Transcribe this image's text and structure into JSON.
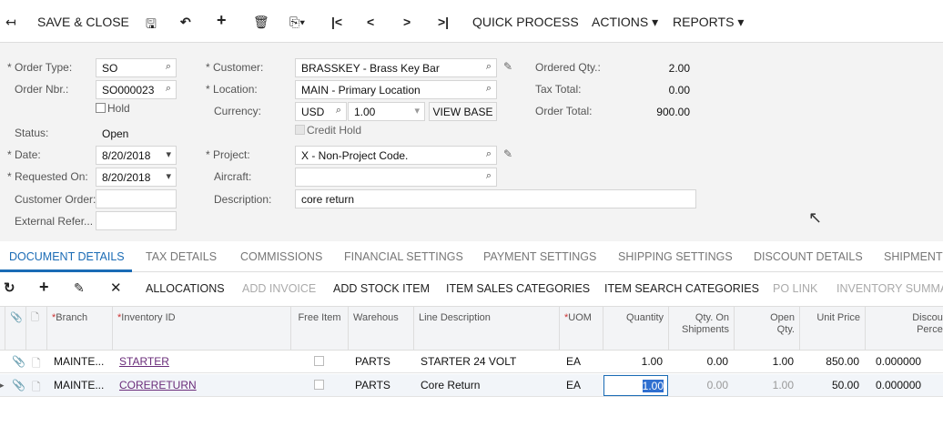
{
  "toolbar": {
    "save_close": "SAVE & CLOSE",
    "quick_process": "QUICK PROCESS",
    "actions": "ACTIONS",
    "reports": "REPORTS"
  },
  "form": {
    "order_type_label": "Order Type:",
    "order_type": "SO",
    "order_nbr_label": "Order Nbr.:",
    "order_nbr": "SO000023",
    "hold_label": "Hold",
    "status_label": "Status:",
    "status": "Open",
    "date_label": "Date:",
    "date": "8/20/2018",
    "requested_on_label": "Requested On:",
    "requested_on": "8/20/2018",
    "customer_order_label": "Customer Order:",
    "customer_order": "",
    "external_ref_label": "External Refer...",
    "external_ref": "",
    "customer_label": "Customer:",
    "customer": "BRASSKEY - Brass Key Bar",
    "location_label": "Location:",
    "location": "MAIN - Primary Location",
    "currency_label": "Currency:",
    "currency": "USD",
    "rate": "1.00",
    "view_base": "VIEW BASE",
    "credit_hold_label": "Credit Hold",
    "project_label": "Project:",
    "project": "X - Non-Project Code.",
    "aircraft_label": "Aircraft:",
    "aircraft": "",
    "description_label": "Description:",
    "description": "core return",
    "ordered_qty_label": "Ordered Qty.:",
    "ordered_qty": "2.00",
    "tax_total_label": "Tax Total:",
    "tax_total": "0.00",
    "order_total_label": "Order Total:",
    "order_total": "900.00"
  },
  "tabs": [
    "DOCUMENT DETAILS",
    "TAX DETAILS",
    "COMMISSIONS",
    "FINANCIAL SETTINGS",
    "PAYMENT SETTINGS",
    "SHIPPING SETTINGS",
    "DISCOUNT DETAILS",
    "SHIPMENTS"
  ],
  "grid_toolbar": {
    "allocations": "ALLOCATIONS",
    "add_invoice": "ADD INVOICE",
    "add_stock_item": "ADD STOCK ITEM",
    "item_sales_categories": "ITEM SALES CATEGORIES",
    "item_search_categories": "ITEM SEARCH CATEGORIES",
    "po_link": "PO LINK",
    "inventory_summary": "INVENTORY SUMMARY"
  },
  "columns": {
    "branch": "Branch",
    "inventory_id": "Inventory ID",
    "free_item": "Free Item",
    "warehouse": "Warehous",
    "line_description": "Line Description",
    "uom": "UOM",
    "quantity": "Quantity",
    "qty_on_shipments": "Qty. On Shipments",
    "open_qty": "Open Qty.",
    "unit_price": "Unit Price",
    "discount_percent": "Discount Percent"
  },
  "rows": [
    {
      "branch": "MAINTE...",
      "inventory_id": "STARTER",
      "warehouse": "PARTS",
      "line_description": "STARTER 24 VOLT",
      "uom": "EA",
      "quantity": "1.00",
      "qty_on_shipments": "0.00",
      "open_qty": "1.00",
      "unit_price": "850.00",
      "discount_percent": "0.000000"
    },
    {
      "branch": "MAINTE...",
      "inventory_id": "CORERETURN",
      "warehouse": "PARTS",
      "line_description": "Core Return",
      "uom": "EA",
      "quantity": "1.00",
      "qty_on_shipments": "0.00",
      "open_qty": "1.00",
      "unit_price": "50.00",
      "discount_percent": "0.000000"
    }
  ]
}
